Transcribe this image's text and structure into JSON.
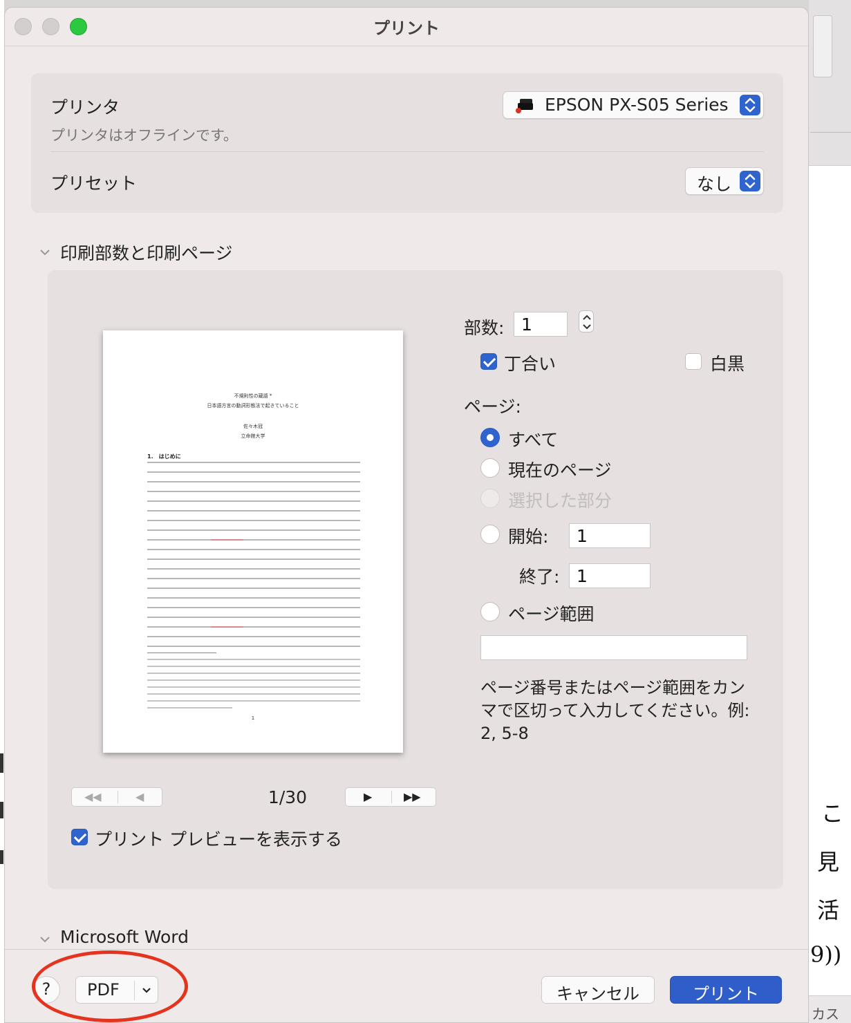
{
  "window": {
    "title": "プリント"
  },
  "printer": {
    "label": "プリンタ",
    "status": "プリンタはオフラインです。",
    "selected": "EPSON PX-S05 Series"
  },
  "preset": {
    "label": "プリセット",
    "selected": "なし"
  },
  "copies_section": {
    "header": "印刷部数と印刷ページ",
    "copies_label": "部数:",
    "copies_value": "1",
    "collate_label": "丁合い",
    "collate_checked": true,
    "bw_label": "白黒",
    "bw_checked": false,
    "pages_label": "ページ:",
    "options": {
      "all": "すべて",
      "current": "現在のページ",
      "selection": "選択した部分",
      "from": "開始:",
      "to": "終了:",
      "range": "ページ範囲"
    },
    "selected_option": "all",
    "from_value": "1",
    "to_value": "1",
    "range_value": "",
    "hint": "ページ番号またはページ範囲をカンマで区切って入力してください。例: 2, 5-8"
  },
  "preview": {
    "page_indicator": "1/30",
    "doc_title_1": "不規則性の蔵語 *",
    "doc_title_2": "日本語方言の動詞形態法で起きていること",
    "doc_author": "佐々木冠",
    "doc_affiliation": "立命館大学",
    "doc_heading": "1.　はじめに",
    "doc_page_number": "1",
    "nav_first": "◀◀",
    "nav_prev": "◀",
    "nav_next": "▶",
    "nav_last": "▶▶"
  },
  "show_preview": {
    "label": "プリント プレビューを表示する",
    "checked": true
  },
  "app_section": {
    "header": "Microsoft Word"
  },
  "footer": {
    "help": "?",
    "pdf": "PDF",
    "cancel": "キャンセル",
    "print": "プリント"
  },
  "background": {
    "line_1": "こ",
    "line_2": "見",
    "line_3": "活",
    "line_4": "9))",
    "status": "カス"
  },
  "colors": {
    "accent": "#2f64cf",
    "annotation": "#e4341f",
    "close_button": "#2bc840"
  }
}
